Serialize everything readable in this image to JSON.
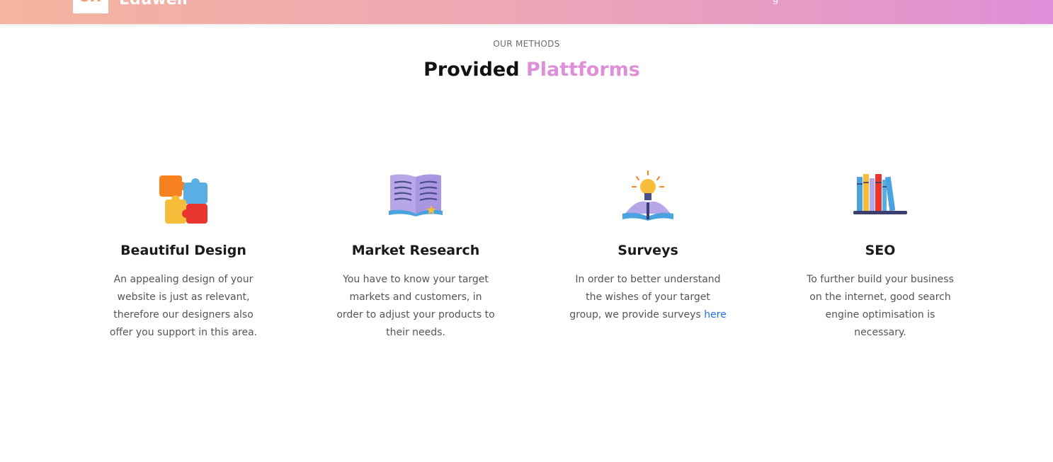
{
  "nav": {
    "logo_text": "UX",
    "brand": "Eduwell",
    "nav_item_fragment": "g"
  },
  "section": {
    "eyebrow": "OUR METHODS",
    "title_main": "Provided",
    "title_accent": "Plattforms"
  },
  "cards": [
    {
      "icon": "puzzle-icon",
      "title": "Beautiful Design",
      "text": "An appealing design of your website is just as relevant, therefore our designers also offer you support in this area."
    },
    {
      "icon": "open-book-icon",
      "title": "Market Research",
      "text": "You have to know your target markets and customers, in order to adjust your products to their needs."
    },
    {
      "icon": "lightbulb-book-icon",
      "title": "Surveys",
      "text_before": "In order to better understand the wishes of your target group, we provide surveys",
      "link": "here"
    },
    {
      "icon": "bookshelf-icon",
      "title": "SEO",
      "text": "To further build your business on the internet, good search engine optimisation is necessary."
    }
  ],
  "colors": {
    "accent": "#dd8fd8",
    "link": "#1a73e8"
  }
}
